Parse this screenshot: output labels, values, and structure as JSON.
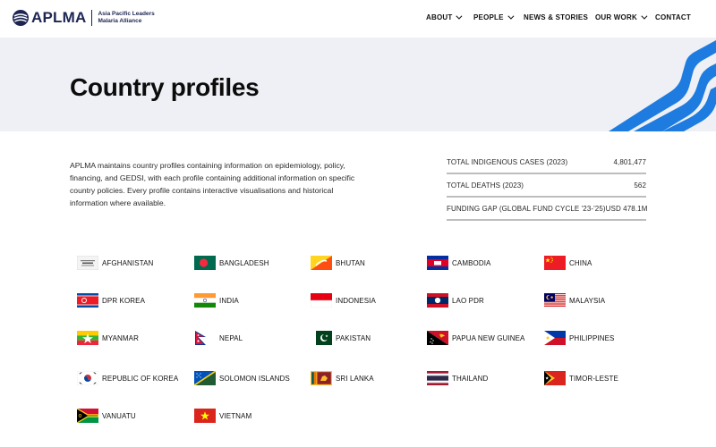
{
  "header": {
    "logo": {
      "wordmark": "APLMA",
      "tagline_line1": "Asia Pacific Leaders",
      "tagline_line2": "Malaria Alliance"
    },
    "nav": [
      {
        "label": "ABOUT",
        "has_dropdown": true
      },
      {
        "label": "PEOPLE",
        "has_dropdown": true
      },
      {
        "label": "NEWS & STORIES",
        "has_dropdown": false
      },
      {
        "label": "OUR WORK",
        "has_dropdown": true
      },
      {
        "label": "CONTACT",
        "has_dropdown": false
      }
    ]
  },
  "hero": {
    "title": "Country profiles"
  },
  "intro": {
    "text": "APLMA maintains country profiles containing information on epidemiology, policy, financing, and GEDSI, with each profile containing additional information on specific country policies. Every profile contains interactive visualisations and historical information where available."
  },
  "stats": [
    {
      "label": "TOTAL INDIGENOUS CASES (2023)",
      "value": "4,801,477"
    },
    {
      "label": "TOTAL DEATHS (2023)",
      "value": "562"
    },
    {
      "label": "FUNDING GAP (GLOBAL FUND CYCLE '23-'25)",
      "value": "USD 478.1M"
    }
  ],
  "countries": [
    {
      "name": "AFGHANISTAN",
      "flag": "afghanistan"
    },
    {
      "name": "BANGLADESH",
      "flag": "bangladesh"
    },
    {
      "name": "BHUTAN",
      "flag": "bhutan"
    },
    {
      "name": "CAMBODIA",
      "flag": "cambodia"
    },
    {
      "name": "CHINA",
      "flag": "china"
    },
    {
      "name": "DPR KOREA",
      "flag": "dpr-korea"
    },
    {
      "name": "INDIA",
      "flag": "india"
    },
    {
      "name": "INDONESIA",
      "flag": "indonesia"
    },
    {
      "name": "LAO PDR",
      "flag": "lao"
    },
    {
      "name": "MALAYSIA",
      "flag": "malaysia"
    },
    {
      "name": "MYANMAR",
      "flag": "myanmar"
    },
    {
      "name": "NEPAL",
      "flag": "nepal"
    },
    {
      "name": "PAKISTAN",
      "flag": "pakistan"
    },
    {
      "name": "PAPUA NEW GUINEA",
      "flag": "png"
    },
    {
      "name": "PHILIPPINES",
      "flag": "philippines"
    },
    {
      "name": "REPUBLIC OF KOREA",
      "flag": "korea"
    },
    {
      "name": "SOLOMON ISLANDS",
      "flag": "solomon-islands"
    },
    {
      "name": "SRI LANKA",
      "flag": "sri-lanka"
    },
    {
      "name": "THAILAND",
      "flag": "thailand"
    },
    {
      "name": "TIMOR-LESTE",
      "flag": "timor-leste"
    },
    {
      "name": "VANUATU",
      "flag": "vanuatu"
    },
    {
      "name": "VIETNAM",
      "flag": "vietnam"
    }
  ],
  "colors": {
    "brand_navy": "#1d2552",
    "accent_blue": "#1e7be0",
    "hero_bg": "#eef0f5"
  }
}
